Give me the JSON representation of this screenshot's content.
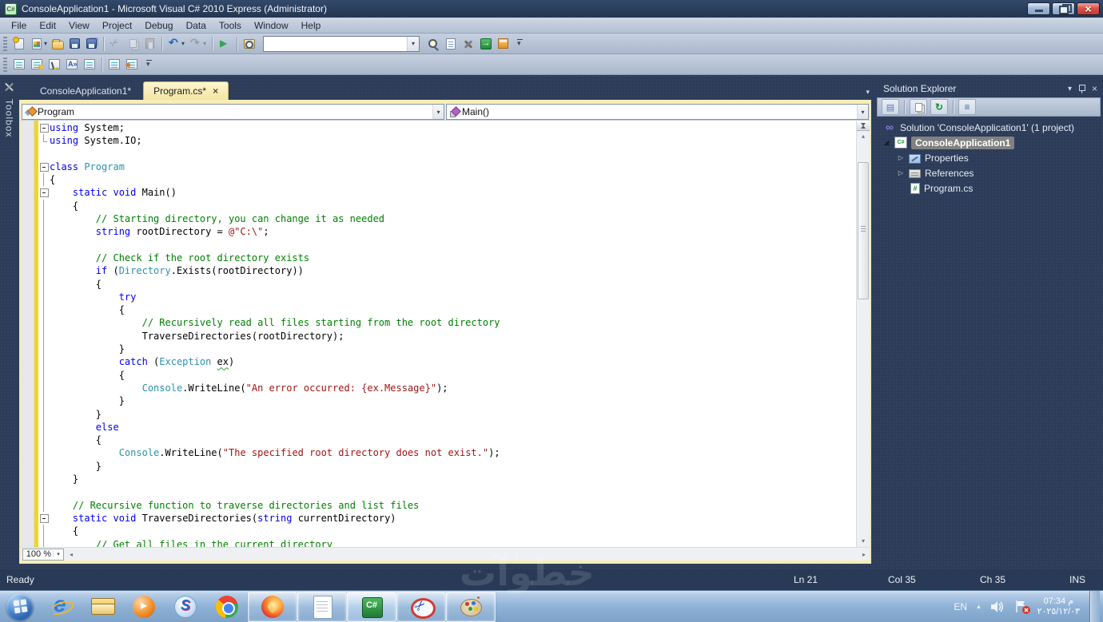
{
  "window": {
    "title": "ConsoleApplication1 - Microsoft Visual C# 2010 Express (Administrator)",
    "app_icon": "C#",
    "controls": [
      "minimize",
      "restore",
      "close"
    ]
  },
  "menus": [
    "File",
    "Edit",
    "View",
    "Project",
    "Debug",
    "Data",
    "Tools",
    "Window",
    "Help"
  ],
  "toolbar_standard": {
    "search_value": "",
    "items": [
      {
        "n": "new-project-icon"
      },
      {
        "n": "add-item-icon",
        "caret": true
      },
      {
        "n": "open-file-icon"
      },
      {
        "n": "save-icon"
      },
      {
        "n": "save-all-icon"
      },
      {
        "sep": true
      },
      {
        "n": "cut-icon",
        "disabled": true
      },
      {
        "n": "copy-icon",
        "disabled": true
      },
      {
        "n": "paste-icon",
        "disabled": true
      },
      {
        "sep": true
      },
      {
        "n": "undo-icon",
        "caret": true
      },
      {
        "n": "redo-icon",
        "caret": true,
        "disabled": true
      },
      {
        "sep": true
      },
      {
        "n": "start-debug-icon"
      },
      {
        "sep": true
      },
      {
        "n": "find-icon"
      },
      {
        "combo": true
      },
      {
        "n": "find-symbol-icon"
      },
      {
        "n": "properties-window-icon"
      },
      {
        "n": "extension-manager-icon"
      },
      {
        "n": "navigate-icon"
      },
      {
        "n": "solution-explorer-icon"
      },
      {
        "n": "toolbar-overflow-icon"
      }
    ]
  },
  "toolbar_text": {
    "items": [
      {
        "n": "member-list-icon"
      },
      {
        "n": "parameter-info-icon"
      },
      {
        "n": "quick-info-icon"
      },
      {
        "n": "complete-word-icon"
      },
      {
        "n": "comment-lines-icon"
      },
      {
        "sep": true
      },
      {
        "n": "decrease-indent-icon"
      },
      {
        "n": "increase-indent-icon"
      },
      {
        "n": "toolbar-overflow-icon"
      }
    ]
  },
  "toolbox": {
    "label": "Toolbox"
  },
  "tabs": [
    {
      "label": "ConsoleApplication1*",
      "active": false,
      "closable": false
    },
    {
      "label": "Program.cs*",
      "active": true,
      "closable": true
    }
  ],
  "navbar": {
    "type_dropdown": "Program",
    "member_dropdown": "Main()"
  },
  "editor": {
    "zoom": "100 %",
    "lines": [
      {
        "g": "box",
        "seg": [
          [
            "k",
            "using"
          ],
          [
            "p",
            " System;"
          ]
        ]
      },
      {
        "g": "end",
        "seg": [
          [
            "k",
            "using"
          ],
          [
            "p",
            " System.IO;"
          ]
        ]
      },
      {
        "g": "",
        "seg": []
      },
      {
        "g": "box",
        "seg": [
          [
            "k",
            "class"
          ],
          [
            "p",
            " "
          ],
          [
            "t",
            "Program"
          ]
        ]
      },
      {
        "g": "line",
        "seg": [
          [
            "p",
            "{"
          ]
        ]
      },
      {
        "g": "box",
        "seg": [
          [
            "p",
            "    "
          ],
          [
            "k",
            "static"
          ],
          [
            "p",
            " "
          ],
          [
            "k",
            "void"
          ],
          [
            "p",
            " Main()"
          ]
        ]
      },
      {
        "g": "line",
        "seg": [
          [
            "p",
            "    {"
          ]
        ]
      },
      {
        "g": "line",
        "seg": [
          [
            "p",
            "        "
          ],
          [
            "c",
            "// Starting directory, you can change it as needed"
          ]
        ]
      },
      {
        "g": "line",
        "seg": [
          [
            "p",
            "        "
          ],
          [
            "k",
            "string"
          ],
          [
            "p",
            " rootDirectory = "
          ],
          [
            "s",
            "@\"C:\\\""
          ],
          [
            "p",
            ";"
          ]
        ]
      },
      {
        "g": "line",
        "seg": []
      },
      {
        "g": "line",
        "seg": [
          [
            "p",
            "        "
          ],
          [
            "c",
            "// Check if the root directory exists"
          ]
        ]
      },
      {
        "g": "line",
        "seg": [
          [
            "p",
            "        "
          ],
          [
            "k",
            "if"
          ],
          [
            "p",
            " ("
          ],
          [
            "t",
            "Directory"
          ],
          [
            "p",
            ".Exists(rootDirectory))"
          ]
        ]
      },
      {
        "g": "line",
        "seg": [
          [
            "p",
            "        {"
          ]
        ]
      },
      {
        "g": "line",
        "seg": [
          [
            "p",
            "            "
          ],
          [
            "k",
            "try"
          ]
        ]
      },
      {
        "g": "line",
        "seg": [
          [
            "p",
            "            {"
          ]
        ]
      },
      {
        "g": "line",
        "seg": [
          [
            "p",
            "                "
          ],
          [
            "c",
            "// Recursively read all files starting from the root directory"
          ]
        ]
      },
      {
        "g": "line",
        "seg": [
          [
            "p",
            "                TraverseDirectories(rootDirectory);"
          ]
        ]
      },
      {
        "g": "line",
        "seg": [
          [
            "p",
            "            }"
          ]
        ]
      },
      {
        "g": "line",
        "seg": [
          [
            "p",
            "            "
          ],
          [
            "k",
            "catch"
          ],
          [
            "p",
            " ("
          ],
          [
            "t",
            "Exception"
          ],
          [
            "p",
            " "
          ],
          [
            "w",
            "ex"
          ],
          [
            "p",
            ")"
          ]
        ]
      },
      {
        "g": "line",
        "seg": [
          [
            "p",
            "            {"
          ]
        ]
      },
      {
        "g": "line",
        "seg": [
          [
            "p",
            "                "
          ],
          [
            "t",
            "Console"
          ],
          [
            "p",
            ".WriteLine("
          ],
          [
            "s",
            "\"An error occurred: {ex.Message}\""
          ],
          [
            "p",
            ");"
          ]
        ]
      },
      {
        "g": "line",
        "seg": [
          [
            "p",
            "            }"
          ]
        ]
      },
      {
        "g": "line",
        "seg": [
          [
            "p",
            "        }"
          ]
        ]
      },
      {
        "g": "line",
        "seg": [
          [
            "p",
            "        "
          ],
          [
            "k",
            "else"
          ]
        ]
      },
      {
        "g": "line",
        "seg": [
          [
            "p",
            "        {"
          ]
        ]
      },
      {
        "g": "line",
        "seg": [
          [
            "p",
            "            "
          ],
          [
            "t",
            "Console"
          ],
          [
            "p",
            ".WriteLine("
          ],
          [
            "s",
            "\"The specified root directory does not exist.\""
          ],
          [
            "p",
            ");"
          ]
        ]
      },
      {
        "g": "line",
        "seg": [
          [
            "p",
            "        }"
          ]
        ]
      },
      {
        "g": "line",
        "seg": [
          [
            "p",
            "    }"
          ]
        ]
      },
      {
        "g": "line",
        "seg": []
      },
      {
        "g": "line",
        "seg": [
          [
            "p",
            "    "
          ],
          [
            "c",
            "// Recursive function to traverse directories and list files"
          ]
        ]
      },
      {
        "g": "box",
        "seg": [
          [
            "p",
            "    "
          ],
          [
            "k",
            "static"
          ],
          [
            "p",
            " "
          ],
          [
            "k",
            "void"
          ],
          [
            "p",
            " TraverseDirectories("
          ],
          [
            "k",
            "string"
          ],
          [
            "p",
            " currentDirectory)"
          ]
        ]
      },
      {
        "g": "line",
        "seg": [
          [
            "p",
            "    {"
          ]
        ]
      },
      {
        "g": "line",
        "seg": [
          [
            "p",
            "        "
          ],
          [
            "c",
            "// Get all files in the current directory"
          ]
        ]
      }
    ]
  },
  "solution_explorer": {
    "title": "Solution Explorer",
    "toolbar": [
      "se-properties-icon",
      "|",
      "show-all-files-icon",
      "refresh-icon",
      "|",
      "view-code-icon"
    ],
    "tree": [
      {
        "icon": "solution",
        "label": "Solution 'ConsoleApplication1' (1 project)",
        "indent": 0,
        "arrow": "none"
      },
      {
        "icon": "csproj",
        "label": "ConsoleApplication1",
        "indent": 1,
        "arrow": "expanded",
        "bold": true,
        "selected": true
      },
      {
        "icon": "properties",
        "label": "Properties",
        "indent": 2,
        "arrow": "collapsed"
      },
      {
        "icon": "references",
        "label": "References",
        "indent": 2,
        "arrow": "collapsed"
      },
      {
        "icon": "csfile",
        "label": "Program.cs",
        "indent": 2,
        "arrow": "none"
      }
    ]
  },
  "statusbar": {
    "ready": "Ready",
    "ln": "Ln 21",
    "col": "Col 35",
    "ch": "Ch 35",
    "mode": "INS"
  },
  "taskbar": {
    "buttons": [
      {
        "n": "internet-explorer-icon"
      },
      {
        "n": "file-explorer-icon"
      },
      {
        "n": "media-player-icon"
      },
      {
        "n": "swirl-browser-icon"
      },
      {
        "n": "chrome-icon"
      },
      {
        "n": "firefox-icon",
        "boxed": true
      },
      {
        "n": "notepad-icon",
        "boxed": true
      },
      {
        "n": "visual-csharp-icon",
        "boxed": true,
        "active": true
      },
      {
        "n": "snipping-tool-icon",
        "boxed": true
      },
      {
        "n": "paint-icon",
        "boxed": true
      }
    ],
    "tray": {
      "lang": "EN",
      "icons": [
        "hidden-icons-chevron",
        "volume-icon",
        "action-center-flag-icon",
        "show-desktop-button"
      ],
      "time": "07:34 م",
      "date": "٢٠٢٥/١٢/٠٣"
    }
  },
  "watermark": "خطوات"
}
